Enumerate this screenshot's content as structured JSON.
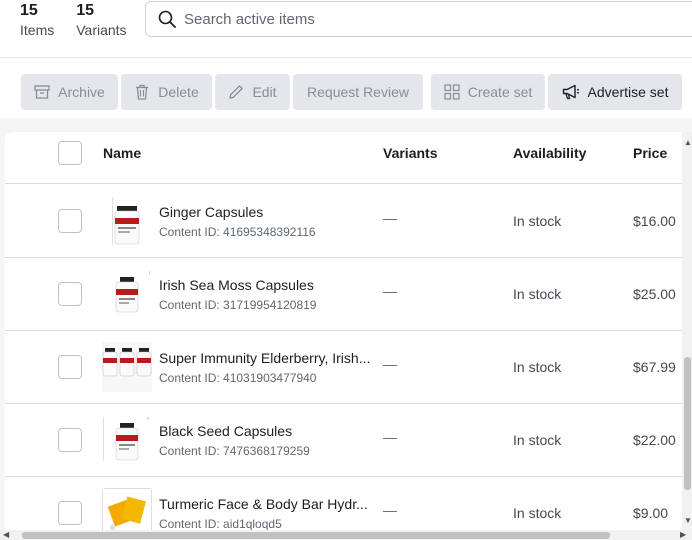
{
  "stats": {
    "items_count": "15",
    "items_label": "Items",
    "variants_count": "15",
    "variants_label": "Variants"
  },
  "search": {
    "placeholder": "Search active items"
  },
  "toolbar": {
    "archive": "Archive",
    "delete": "Delete",
    "edit": "Edit",
    "request_review": "Request Review",
    "create_set": "Create set",
    "advertise_set": "Advertise set"
  },
  "table": {
    "headers": {
      "name": "Name",
      "variants": "Variants",
      "availability": "Availability",
      "price": "Price"
    },
    "rows": [
      {
        "name": "Ginger Capsules",
        "content_id": "Content ID: 41695348392116",
        "variants": "—",
        "availability": "In stock",
        "price": "$16.00",
        "thumb": "ginger-capsules-bottle"
      },
      {
        "name": "Irish Sea Moss Capsules",
        "content_id": "Content ID: 31719954120819",
        "variants": "—",
        "availability": "In stock",
        "price": "$25.00",
        "thumb": "sea-moss-capsules-bottle"
      },
      {
        "name": "Super Immunity Elderberry, Irish...",
        "content_id": "Content ID: 41031903477940",
        "variants": "—",
        "availability": "In stock",
        "price": "$67.99",
        "thumb": "three-bottle-bundle"
      },
      {
        "name": "Black Seed Capsules",
        "content_id": "Content ID: 7476368179259",
        "variants": "—",
        "availability": "In stock",
        "price": "$22.00",
        "thumb": "black-seed-capsules-bottle"
      },
      {
        "name": "Turmeric Face & Body Bar Hydr...",
        "content_id": "Content ID: aid1qloqd5",
        "variants": "—",
        "availability": "In stock",
        "price": "$9.00",
        "thumb": "turmeric-soap-bar"
      }
    ]
  }
}
